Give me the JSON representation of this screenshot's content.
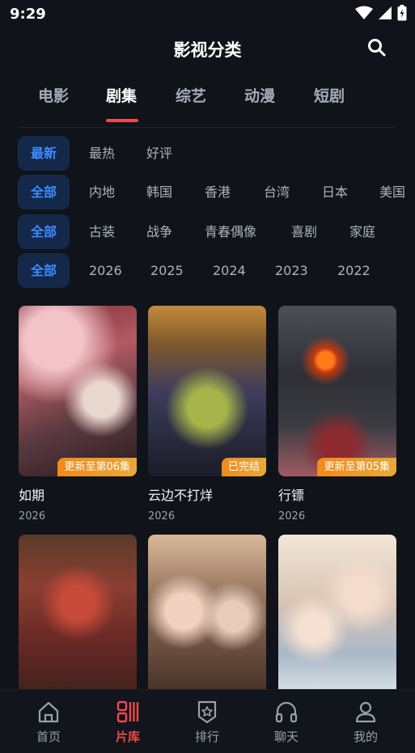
{
  "status": {
    "time": "9:29"
  },
  "header": {
    "title": "影视分类"
  },
  "main_tabs": [
    {
      "label": "电影"
    },
    {
      "label": "剧集",
      "active": true
    },
    {
      "label": "综艺"
    },
    {
      "label": "动漫"
    },
    {
      "label": "短剧"
    }
  ],
  "filters": {
    "sort": [
      "最新",
      "最热",
      "好评"
    ],
    "region": [
      "全部",
      "内地",
      "韩国",
      "香港",
      "台湾",
      "日本",
      "美国"
    ],
    "genre": [
      "全部",
      "古装",
      "战争",
      "青春偶像",
      "喜剧",
      "家庭"
    ],
    "year": [
      "全部",
      "2026",
      "2025",
      "2024",
      "2023",
      "2022"
    ]
  },
  "cards": [
    {
      "title": "如期",
      "year": "2026",
      "badge": "更新至第06集"
    },
    {
      "title": "云边不打烊",
      "year": "2026",
      "badge": "已完结"
    },
    {
      "title": "行镖",
      "year": "2026",
      "badge": "更新至第05集"
    },
    {
      "title": "",
      "year": "",
      "badge": ""
    },
    {
      "title": "",
      "year": "",
      "badge": ""
    },
    {
      "title": "",
      "year": "",
      "badge": ""
    }
  ],
  "bottom_nav": [
    {
      "label": "首页",
      "icon": "home-icon"
    },
    {
      "label": "片库",
      "icon": "library-icon",
      "active": true
    },
    {
      "label": "排行",
      "icon": "ranking-icon"
    },
    {
      "label": "聊天",
      "icon": "headphones-icon"
    },
    {
      "label": "我的",
      "icon": "profile-icon"
    }
  ],
  "colors": {
    "accent_red": "#ef4a4a",
    "chip_blue": "#3d8bff",
    "badge_orange": "#f08a1c",
    "background": "#10131a"
  }
}
